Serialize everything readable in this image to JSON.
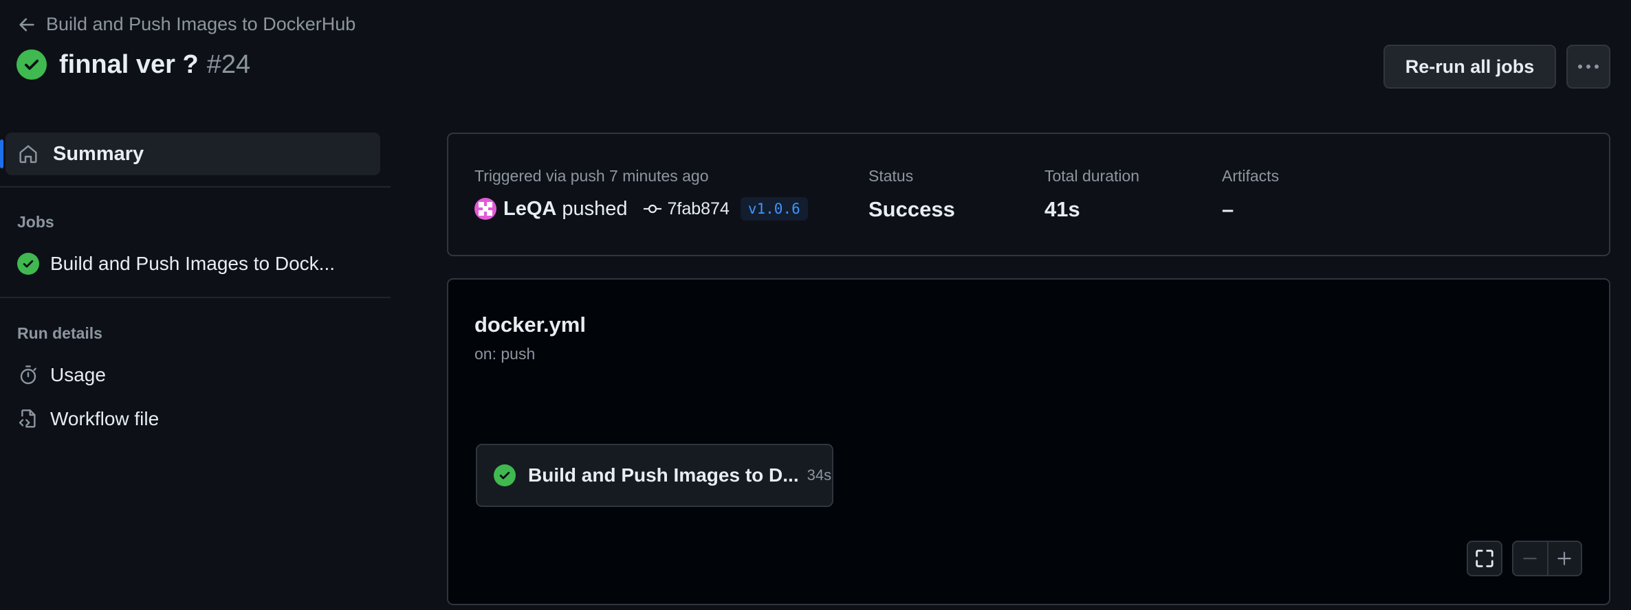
{
  "header": {
    "back_label": "Build and Push Images to DockerHub",
    "run_title": "finnal ver ?",
    "run_number": "#24",
    "rerun_label": "Re-run all jobs"
  },
  "sidebar": {
    "summary_label": "Summary",
    "jobs_section": "Jobs",
    "jobs": [
      {
        "label": "Build and Push Images to Dock...",
        "status": "success"
      }
    ],
    "run_details_section": "Run details",
    "run_details": [
      {
        "label": "Usage",
        "icon": "stopwatch-icon"
      },
      {
        "label": "Workflow file",
        "icon": "file-code-icon"
      }
    ]
  },
  "summary": {
    "triggered_label": "Triggered via push 7 minutes ago",
    "actor": "LeQA",
    "action": "pushed",
    "commit": "7fab874",
    "tag": "v1.0.6",
    "status_label": "Status",
    "status_value": "Success",
    "duration_label": "Total duration",
    "duration_value": "41s",
    "artifacts_label": "Artifacts",
    "artifacts_value": "–"
  },
  "graph": {
    "workflow_name": "docker.yml",
    "trigger": "on: push",
    "job": {
      "name": "Build and Push Images to D...",
      "duration": "34s",
      "status": "success"
    }
  },
  "colors": {
    "background": "#0d1117",
    "success": "#3fb950",
    "accent": "#1f6feb",
    "tag_text": "#4493f8"
  }
}
